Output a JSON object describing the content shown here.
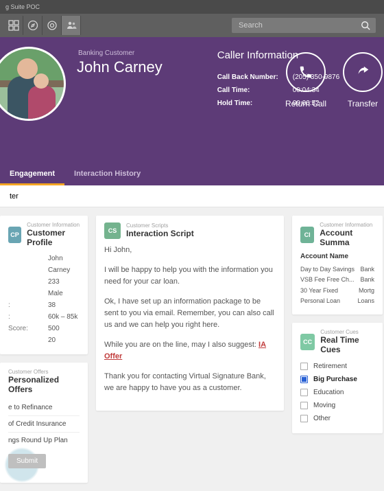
{
  "app_title": "g Suite POC",
  "search": {
    "placeholder": "Search"
  },
  "hero": {
    "customer_type": "Banking Customer",
    "customer_name": "John Carney",
    "caller_title": "Caller Information",
    "callback_label": "Call Back Number:",
    "callback_value": "(205) 350-9876",
    "calltime_label": "Call Time:",
    "calltime_value": "00:04:34",
    "holdtime_label": "Hold Time:",
    "holdtime_value": "00:00:52",
    "return_call": "Return Call",
    "transfer": "Transfer"
  },
  "tabs": {
    "engagement": "Engagement",
    "history": "Interaction History"
  },
  "subheader": "ter",
  "profile": {
    "supertitle": "Customer Information",
    "title": "Customer Profile",
    "rows": [
      {
        "k": "",
        "v": "John Carney"
      },
      {
        "k": "",
        "v": "233"
      },
      {
        "k": "",
        "v": "Male"
      },
      {
        "k": ":",
        "v": "38"
      },
      {
        "k": ":",
        "v": "60k – 85k"
      },
      {
        "k": "Score:",
        "v": "500"
      },
      {
        "k": "",
        "v": "20"
      }
    ]
  },
  "offers": {
    "supertitle": "Customer Offers",
    "title": "Personalized Offers",
    "items": [
      "e to Refinance",
      "of Credit Insurance",
      "ngs Round Up Plan"
    ],
    "submit": "Submit"
  },
  "script": {
    "supertitle": "Customer Scripts",
    "title": "Interaction Script",
    "p1": "Hi John,",
    "p2": "I will be happy to help you with the information you need for your car loan.",
    "p3": "Ok, I have set up an information package to be sent to you via email. Remember, you can also call us and we can help you right here.",
    "p4_pre": "While you are on the line, may I also suggest: ",
    "p4_link": "IA Offer",
    "p5": "Thank you for contacting Virtual Signature Bank, we are happy to have you as a customer."
  },
  "accounts": {
    "supertitle": "Customer Information",
    "title": "Account Summa",
    "head_name": "Account Name",
    "rows": [
      {
        "name": "Day to Day Savings",
        "type": "Bank"
      },
      {
        "name": "VSB Fee Free Ch...",
        "type": "Bank"
      },
      {
        "name": "30 Year Fixed",
        "type": "Mortg"
      },
      {
        "name": "Personal Loan",
        "type": "Loans"
      }
    ]
  },
  "cues": {
    "supertitle": "Customer Cues",
    "title": "Real Time Cues",
    "items": [
      {
        "label": "Retirement",
        "checked": false,
        "bold": false
      },
      {
        "label": "Big Purchase",
        "checked": true,
        "bold": true
      },
      {
        "label": "Education",
        "checked": false,
        "bold": false
      },
      {
        "label": "Moving",
        "checked": false,
        "bold": false
      },
      {
        "label": "Other",
        "checked": false,
        "bold": false
      }
    ]
  }
}
